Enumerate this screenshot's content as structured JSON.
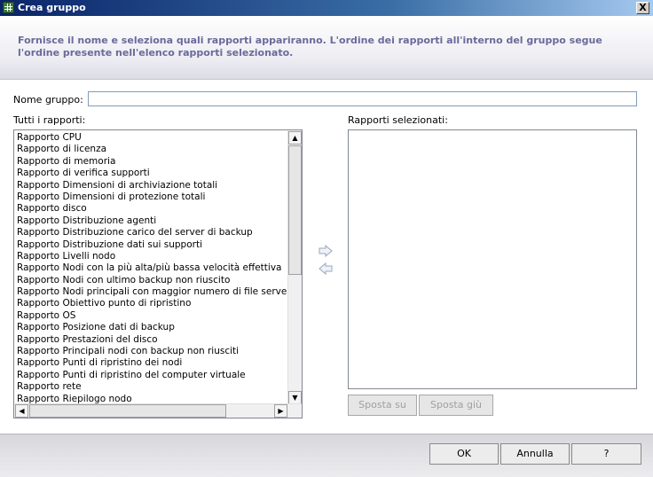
{
  "window": {
    "title": "Crea gruppo",
    "close_label": "X"
  },
  "header": {
    "description": "Fornisce il nome e seleziona quali rapporti appariranno. L'ordine dei rapporti all'interno del gruppo segue l'ordine presente nell'elenco rapporti selezionato."
  },
  "form": {
    "name_label": "Nome gruppo:",
    "name_value": "",
    "all_reports_label": "Tutti i rapporti:",
    "selected_reports_label": "Rapporti selezionati:"
  },
  "all_reports": [
    "Rapporto CPU",
    "Rapporto di licenza",
    "Rapporto di memoria",
    "Rapporto di verifica supporti",
    "Rapporto Dimensioni di archiviazione totali",
    "Rapporto Dimensioni di protezione totali",
    "Rapporto disco",
    "Rapporto Distribuzione agenti",
    "Rapporto Distribuzione carico del server di backup",
    "Rapporto Distribuzione dati sui supporti",
    "Rapporto Livelli nodo",
    "Rapporto Nodi con la più alta/più bassa velocità effettiva",
    "Rapporto Nodi con ultimo backup non riuscito",
    "Rapporto Nodi principali con maggior numero di file server",
    "Rapporto Obiettivo punto di ripristino",
    "Rapporto OS",
    "Rapporto Posizione dati di backup",
    "Rapporto Prestazioni del disco",
    "Rapporto Principali nodi con backup non riusciti",
    "Rapporto Punti di ripristino dei nodi",
    "Rapporto Punti di ripristino del computer virtuale",
    "Rapporto rete",
    "Rapporto Riepilogo nodo"
  ],
  "selected_reports": [],
  "buttons": {
    "move_up": "Sposta su",
    "move_down": "Sposta giù",
    "ok": "OK",
    "cancel": "Annulla",
    "help": "?"
  },
  "icons": {
    "add": "arrow-right-icon",
    "remove": "arrow-left-icon"
  }
}
